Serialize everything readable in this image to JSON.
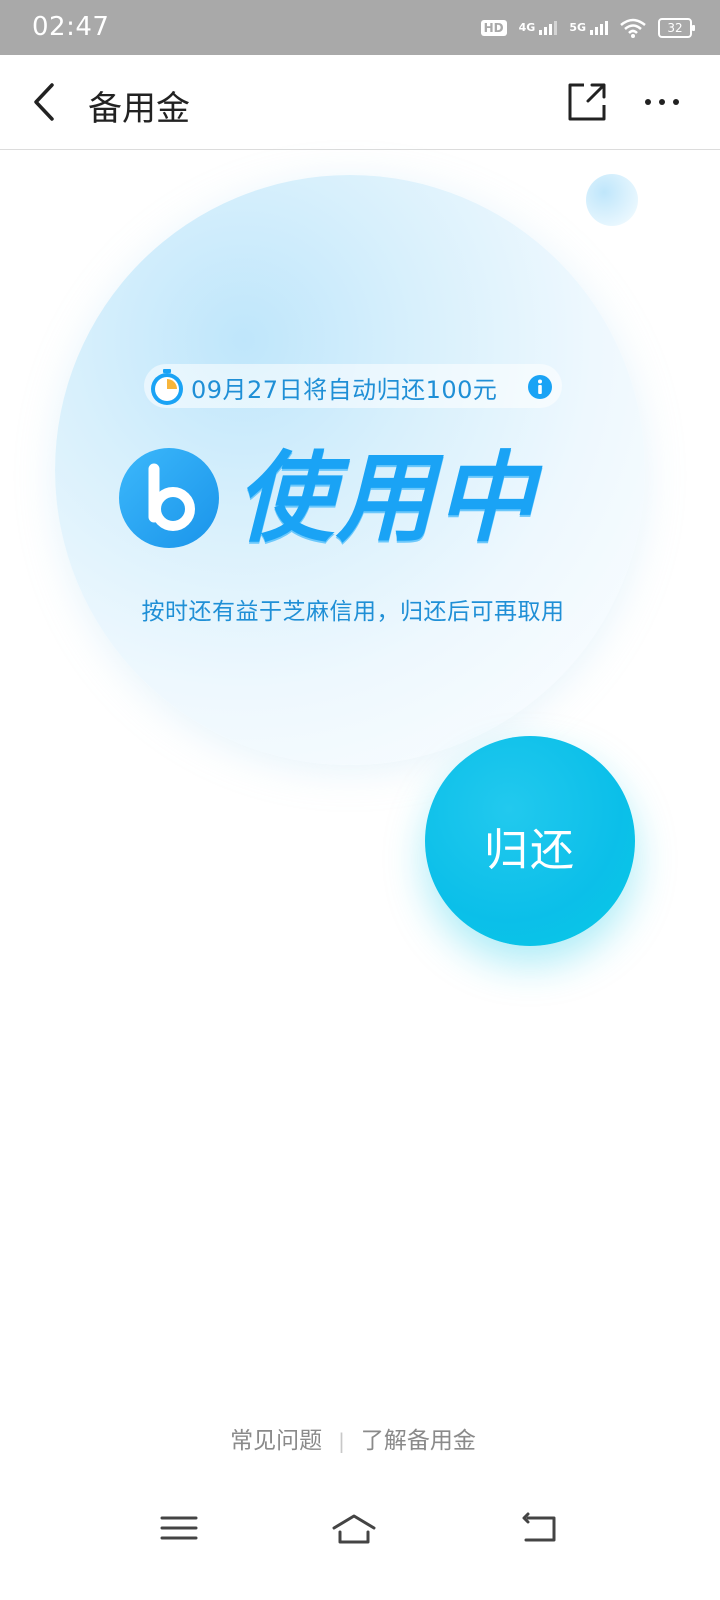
{
  "status_bar": {
    "time": "02:47",
    "hd_label": "HD",
    "net1_label": "4G",
    "net2_label": "5G",
    "battery": "32"
  },
  "nav": {
    "title": "备用金",
    "back_icon": "chevron-left-icon",
    "share_icon": "share-external-icon",
    "more_icon": "more-dots-icon"
  },
  "main": {
    "due_notice": "09月27日将自动归还100元",
    "status_title": "使用中",
    "subtitle": "按时还有益于芝麻信用，归还后可再取用",
    "return_button": "归还"
  },
  "footer": {
    "faq_link": "常见问题",
    "separator": "|",
    "about_link": "了解备用金"
  },
  "colors": {
    "accent_blue": "#1aa3f5",
    "text_blue": "#1f8fd6",
    "cyan_button": "#0bbfe9",
    "timer_yellow": "#f7b53b"
  }
}
